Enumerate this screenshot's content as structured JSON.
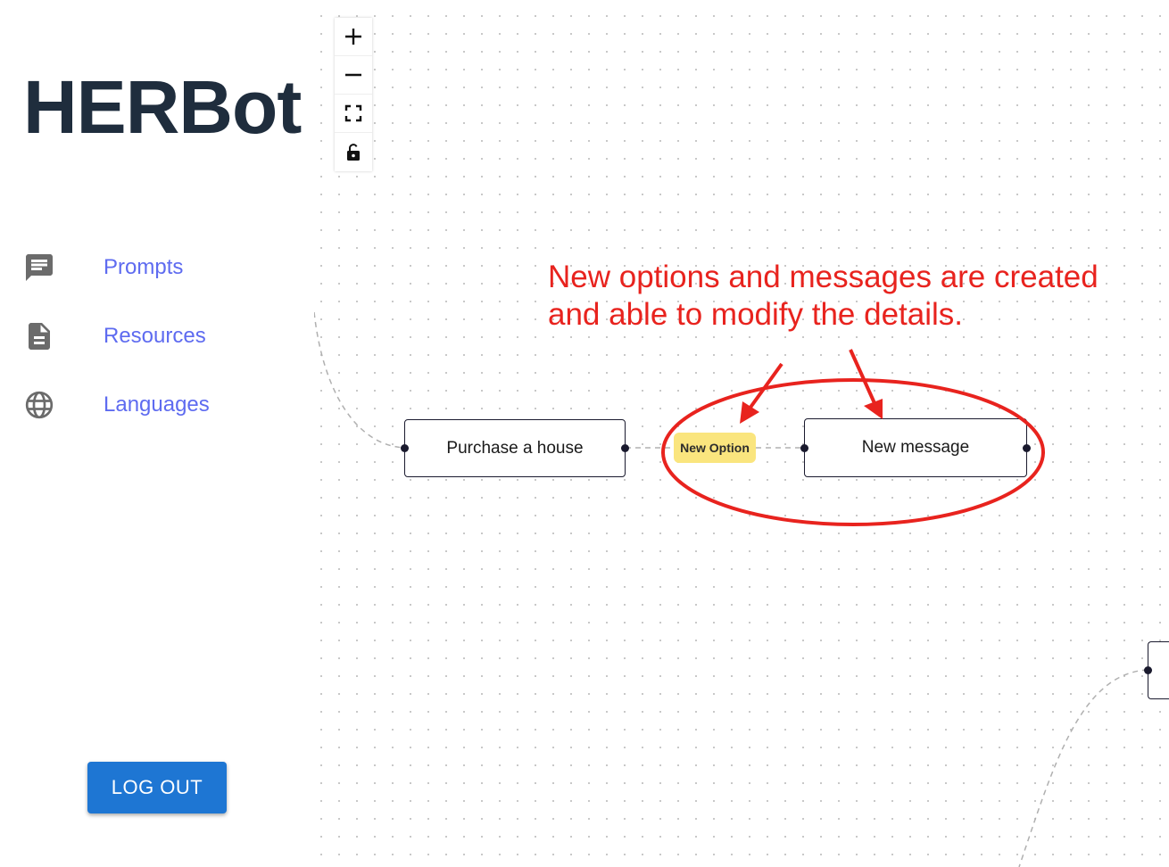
{
  "app": {
    "title": "HERBot"
  },
  "sidebar": {
    "items": [
      {
        "label": "Prompts",
        "icon": "chat-icon"
      },
      {
        "label": "Resources",
        "icon": "document-icon"
      },
      {
        "label": "Languages",
        "icon": "globe-icon"
      }
    ],
    "logout_label": "LOG OUT"
  },
  "controls": [
    "zoom-in-icon",
    "zoom-out-icon",
    "fit-view-icon",
    "lock-icon"
  ],
  "flow": {
    "nodes": [
      {
        "label": "Purchase a house"
      },
      {
        "label": "New message"
      },
      {
        "label": ""
      }
    ],
    "option_badge": "New Option"
  },
  "annotation": {
    "line1": "New options and messages are created",
    "line2": "and able to modify the details."
  },
  "colors": {
    "brand_text": "#1f2d3d",
    "nav_link": "#5e6bf0",
    "logout_button": "#1e76d3",
    "option_badge": "#fae57e",
    "annotation": "#e8231e"
  }
}
